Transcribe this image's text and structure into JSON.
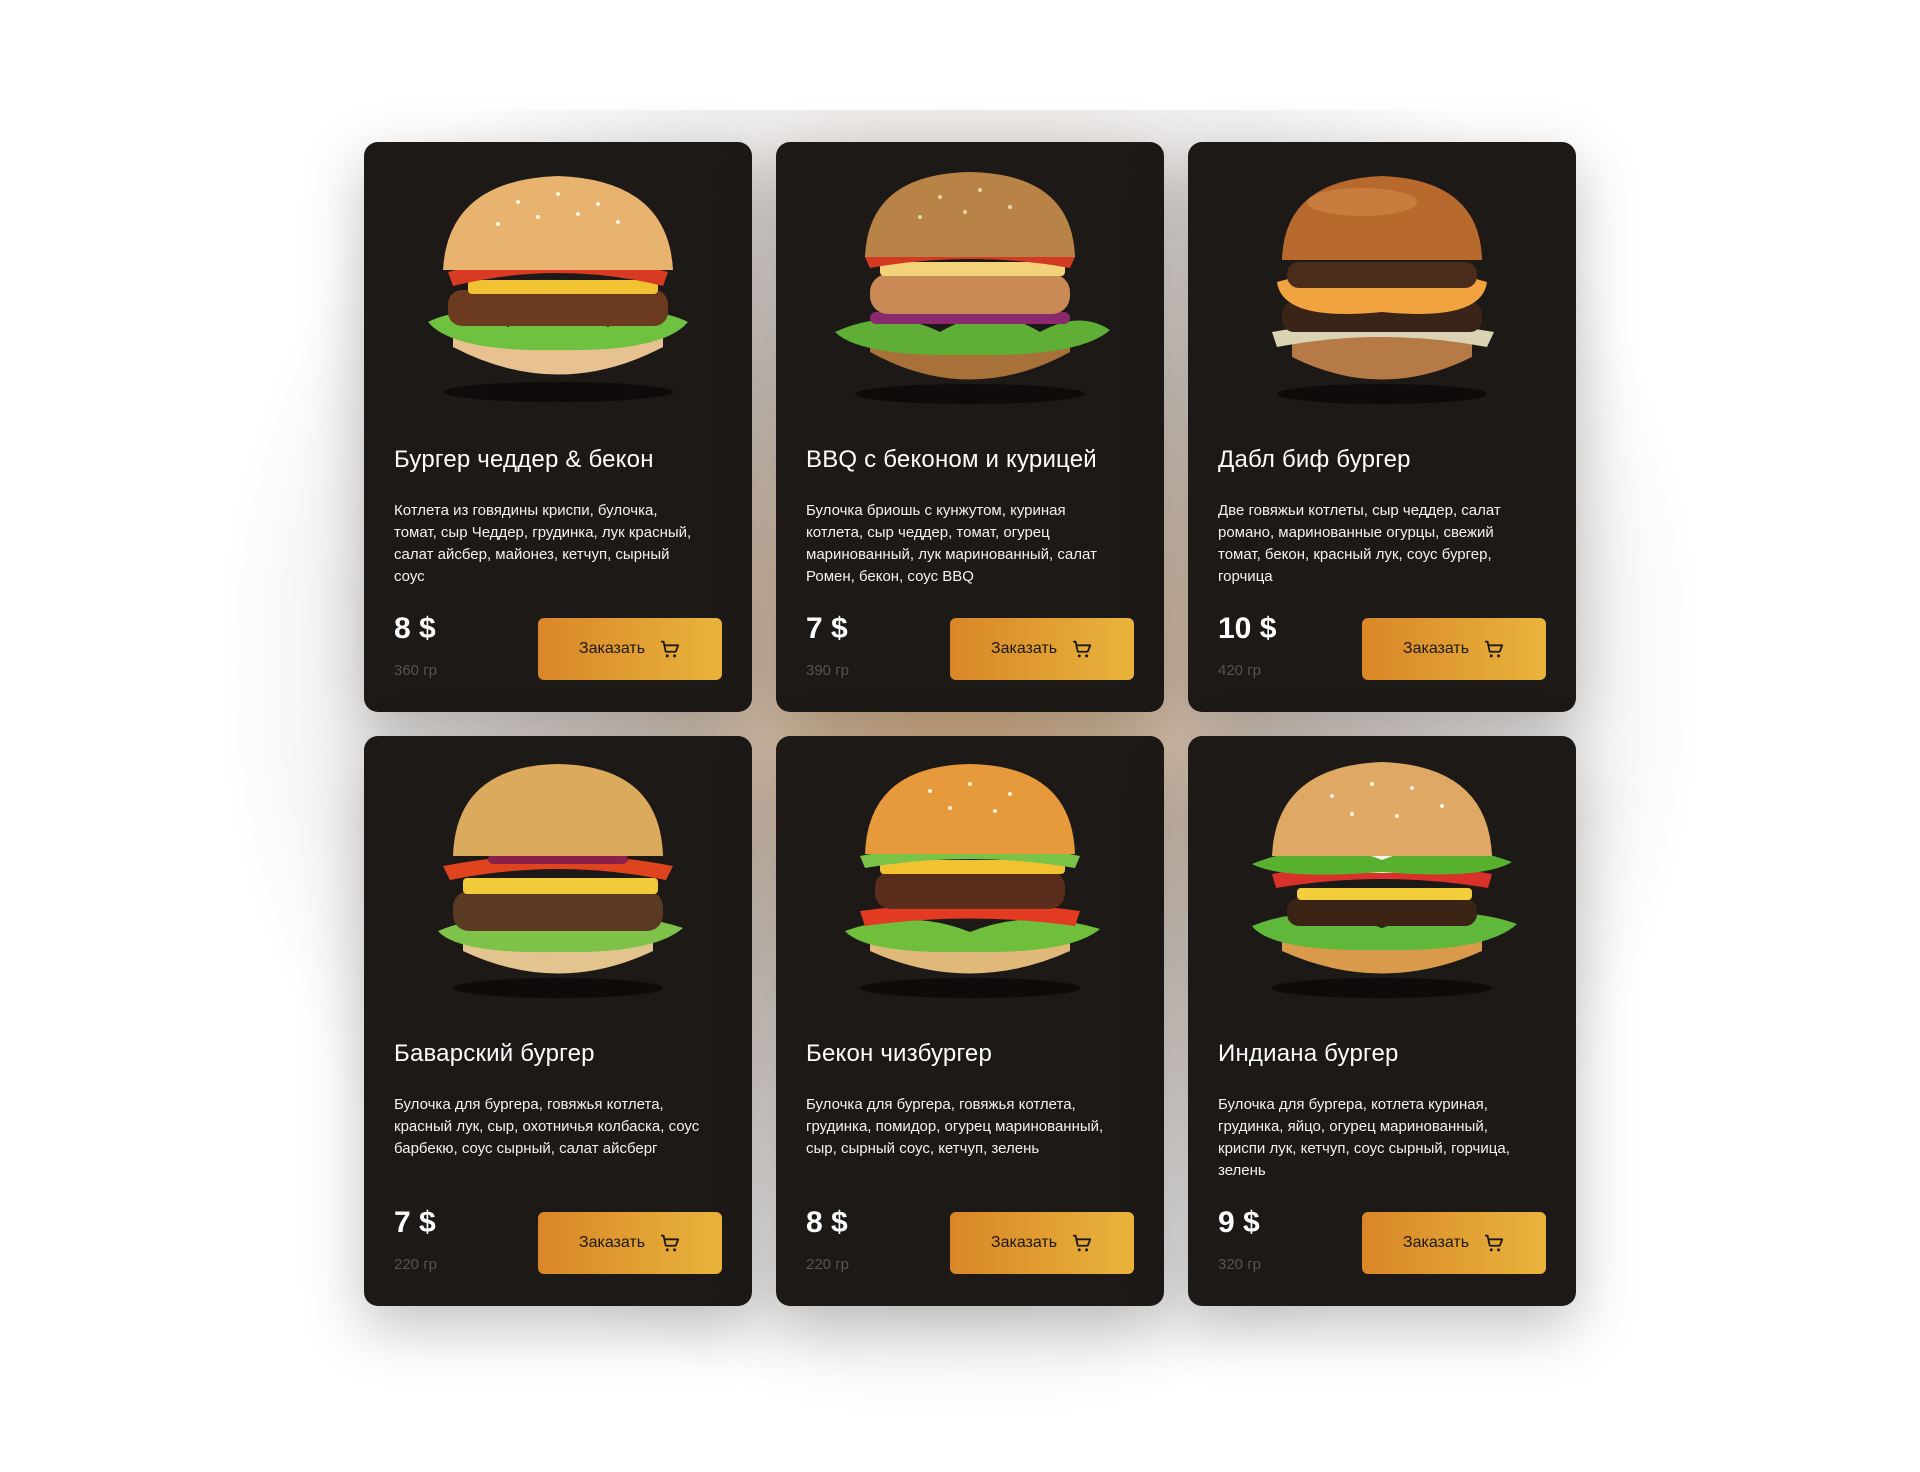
{
  "cards": [
    {
      "title": "Бургер чеддер & бекон",
      "description": "Котлета из говядины криспи, булочка, томат, сыр Чеддер, грудинка, лук красный, салат айсбер, майонез, кетчуп, сырный соус",
      "price": "8 $",
      "weight": "360 гр",
      "button_label": "Заказать",
      "icon": "cart-icon"
    },
    {
      "title": "BBQ с беконом и курицей",
      "description": "Булочка бриошь с кунжутом, куриная котлета, сыр чеддер, томат, огурец маринованный, лук маринованный, салат Ромен, бекон, соус BBQ",
      "price": "7 $",
      "weight": "390 гр",
      "button_label": "Заказать",
      "icon": "cart-icon"
    },
    {
      "title": "Дабл биф бургер",
      "description": "Две говяжьи котлеты, сыр чеддер, салат романо, маринованные огурцы, свежий томат, бекон, красный лук, соус бургер, горчица",
      "price": "10 $",
      "weight": "420 гр",
      "button_label": "Заказать",
      "icon": "cart-icon"
    },
    {
      "title": "Баварский бургер",
      "description": "Булочка для бургера, говяжья котлета, красный лук, сыр, охотничья колбаска, соус барбекю, соус сырный, салат айсберг",
      "price": "7 $",
      "weight": "220 гр",
      "button_label": "Заказать",
      "icon": "cart-icon"
    },
    {
      "title": "Бекон чизбургер",
      "description": "Булочка для бургера, говяжья котлета, грудинка, помидор, огурец маринованный, сыр, сырный соус, кетчуп, зелень",
      "price": "8 $",
      "weight": "220 гр",
      "button_label": "Заказать",
      "icon": "cart-icon"
    },
    {
      "title": "Индиана бургер",
      "description": "Булочка для бургера, котлета куриная, грудинка, яйцо, огурец маринованный, криспи лук, кетчуп, соус сырный, горчица, зелень",
      "price": "9 $",
      "weight": "320 гр",
      "button_label": "Заказать",
      "icon": "cart-icon"
    }
  ],
  "colors": {
    "card_background": "#1d1917",
    "button_gradient_start": "#d98627",
    "button_gradient_end": "#e9b43c",
    "weight_text": "#5a524d"
  }
}
